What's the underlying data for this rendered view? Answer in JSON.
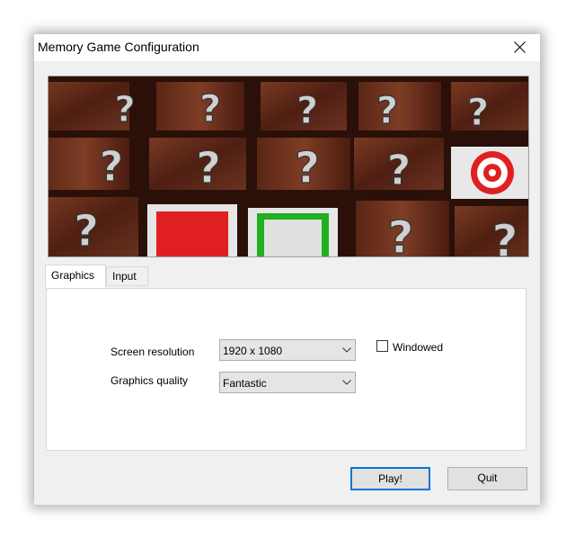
{
  "window": {
    "title": "Memory Game Configuration"
  },
  "banner": {
    "card_glyph": "?"
  },
  "tabs": [
    {
      "label": "Graphics",
      "active": true
    },
    {
      "label": "Input",
      "active": false
    }
  ],
  "graphics": {
    "resolution_label": "Screen resolution",
    "resolution_value": "1920 x 1080",
    "quality_label": "Graphics quality",
    "quality_value": "Fantastic",
    "windowed_label": "Windowed",
    "windowed_checked": false
  },
  "buttons": {
    "play": "Play!",
    "quit": "Quit"
  },
  "colors": {
    "accent": "#0078d7",
    "card_wood": "#5a2a1a",
    "red_card": "#e02020",
    "green_card": "#20b020"
  },
  "icons": {
    "close": "close-icon",
    "dropdown": "chevron-down-icon",
    "target": "target-icon"
  }
}
